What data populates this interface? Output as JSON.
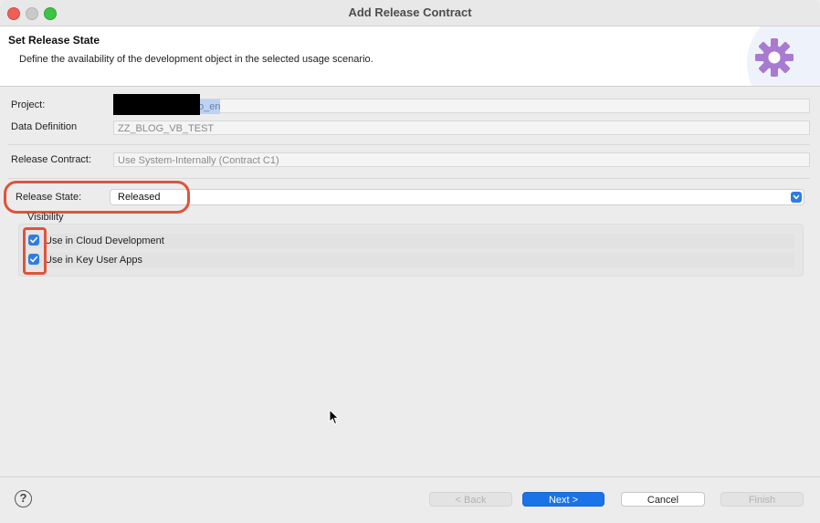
{
  "window": {
    "title": "Add Release Contract"
  },
  "banner": {
    "title": "Set Release State",
    "description": "Define the availability of the development object in the selected usage scenario."
  },
  "form": {
    "project_label": "Project:",
    "project_value_visible": "o_en",
    "data_definition_label": "Data Definition",
    "data_definition_value": "ZZ_BLOG_VB_TEST",
    "release_contract_label": "Release Contract:",
    "release_contract_value": "Use System-Internally (Contract C1)",
    "release_state_label": "Release State:",
    "release_state_value": "Released"
  },
  "visibility": {
    "label": "Visibility",
    "options": [
      {
        "label": "Use in Cloud Development",
        "checked": true
      },
      {
        "label": "Use in Key User Apps",
        "checked": true
      }
    ]
  },
  "footer": {
    "help": "?",
    "back": "< Back",
    "next": "Next >",
    "cancel": "Cancel",
    "finish": "Finish"
  },
  "colors": {
    "accent": "#1a73e8",
    "annotation_red": "#e0533a",
    "gear": "#a87bd1"
  }
}
